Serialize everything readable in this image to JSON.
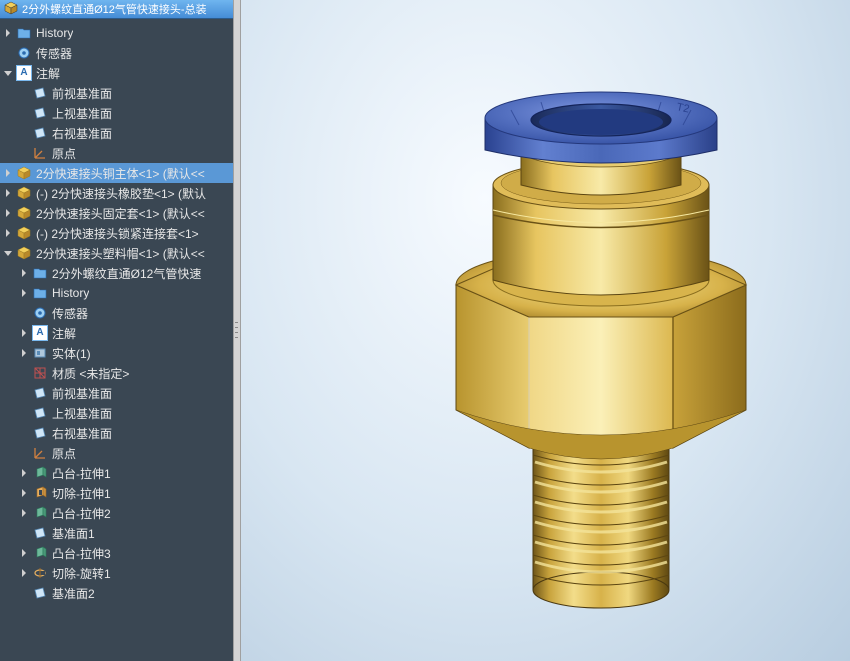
{
  "header": {
    "title": "2分外螺纹直通Ø12气管快速接头-总装"
  },
  "tree": [
    {
      "depth": 0,
      "arrow": "right",
      "icon": "folder",
      "label": "History",
      "selected": false
    },
    {
      "depth": 0,
      "arrow": "none",
      "icon": "sensor",
      "label": "传感器",
      "selected": false
    },
    {
      "depth": 0,
      "arrow": "down",
      "icon": "a",
      "label": "注解",
      "selected": false
    },
    {
      "depth": 1,
      "arrow": "none",
      "icon": "plane",
      "label": "前视基准面",
      "selected": false
    },
    {
      "depth": 1,
      "arrow": "none",
      "icon": "plane",
      "label": "上视基准面",
      "selected": false
    },
    {
      "depth": 1,
      "arrow": "none",
      "icon": "plane",
      "label": "右视基准面",
      "selected": false
    },
    {
      "depth": 1,
      "arrow": "none",
      "icon": "origin",
      "label": "原点",
      "selected": false
    },
    {
      "depth": 0,
      "arrow": "right",
      "icon": "asm-y",
      "label": "2分快速接头铜主体<1> (默认<<",
      "selected": true
    },
    {
      "depth": 0,
      "arrow": "right",
      "icon": "asm-y",
      "label": "(-) 2分快速接头橡胶垫<1> (默认",
      "selected": false
    },
    {
      "depth": 0,
      "arrow": "right",
      "icon": "asm-y",
      "label": "2分快速接头固定套<1> (默认<<",
      "selected": false
    },
    {
      "depth": 0,
      "arrow": "right",
      "icon": "asm-y",
      "label": "(-) 2分快速接头锁紧连接套<1>",
      "selected": false
    },
    {
      "depth": 0,
      "arrow": "down",
      "icon": "asm-y",
      "label": "2分快速接头塑料帽<1> (默认<<",
      "selected": false
    },
    {
      "depth": 1,
      "arrow": "right",
      "icon": "folder",
      "label": "2分外螺纹直通Ø12气管快速",
      "selected": false
    },
    {
      "depth": 1,
      "arrow": "right",
      "icon": "folder",
      "label": "History",
      "selected": false
    },
    {
      "depth": 1,
      "arrow": "none",
      "icon": "sensor",
      "label": "传感器",
      "selected": false
    },
    {
      "depth": 1,
      "arrow": "right",
      "icon": "a",
      "label": "注解",
      "selected": false
    },
    {
      "depth": 1,
      "arrow": "right",
      "icon": "body",
      "label": "实体(1)",
      "selected": false
    },
    {
      "depth": 1,
      "arrow": "none",
      "icon": "material",
      "label": "材质 <未指定>",
      "selected": false
    },
    {
      "depth": 1,
      "arrow": "none",
      "icon": "plane",
      "label": "前视基准面",
      "selected": false
    },
    {
      "depth": 1,
      "arrow": "none",
      "icon": "plane",
      "label": "上视基准面",
      "selected": false
    },
    {
      "depth": 1,
      "arrow": "none",
      "icon": "plane",
      "label": "右视基准面",
      "selected": false
    },
    {
      "depth": 1,
      "arrow": "none",
      "icon": "origin",
      "label": "原点",
      "selected": false
    },
    {
      "depth": 1,
      "arrow": "right",
      "icon": "extrude",
      "label": "凸台-拉伸1",
      "selected": false
    },
    {
      "depth": 1,
      "arrow": "right",
      "icon": "cut",
      "label": "切除-拉伸1",
      "selected": false
    },
    {
      "depth": 1,
      "arrow": "right",
      "icon": "extrude",
      "label": "凸台-拉伸2",
      "selected": false
    },
    {
      "depth": 1,
      "arrow": "none",
      "icon": "plane",
      "label": "基准面1",
      "selected": false
    },
    {
      "depth": 1,
      "arrow": "right",
      "icon": "extrude",
      "label": "凸台-拉伸3",
      "selected": false
    },
    {
      "depth": 1,
      "arrow": "right",
      "icon": "revolve",
      "label": "切除-旋转1",
      "selected": false
    },
    {
      "depth": 1,
      "arrow": "none",
      "icon": "plane",
      "label": "基准面2",
      "selected": false
    }
  ],
  "model": {
    "description": "Brass pneumatic quick connect fitting with blue plastic release collar, hex body, and external thread",
    "top_ring_text": "T2"
  },
  "colors": {
    "tree_bg": "#3a4753",
    "tree_selection": "#5a98d6",
    "header_gradient_top": "#6fb5ef",
    "header_gradient_bottom": "#458cd6",
    "brass_light": "#e8c765",
    "brass_mid": "#caa238",
    "brass_dark": "#8a6e1e",
    "blue_ring": "#4f6fc5",
    "blue_ring_dark": "#2a4a9a"
  }
}
